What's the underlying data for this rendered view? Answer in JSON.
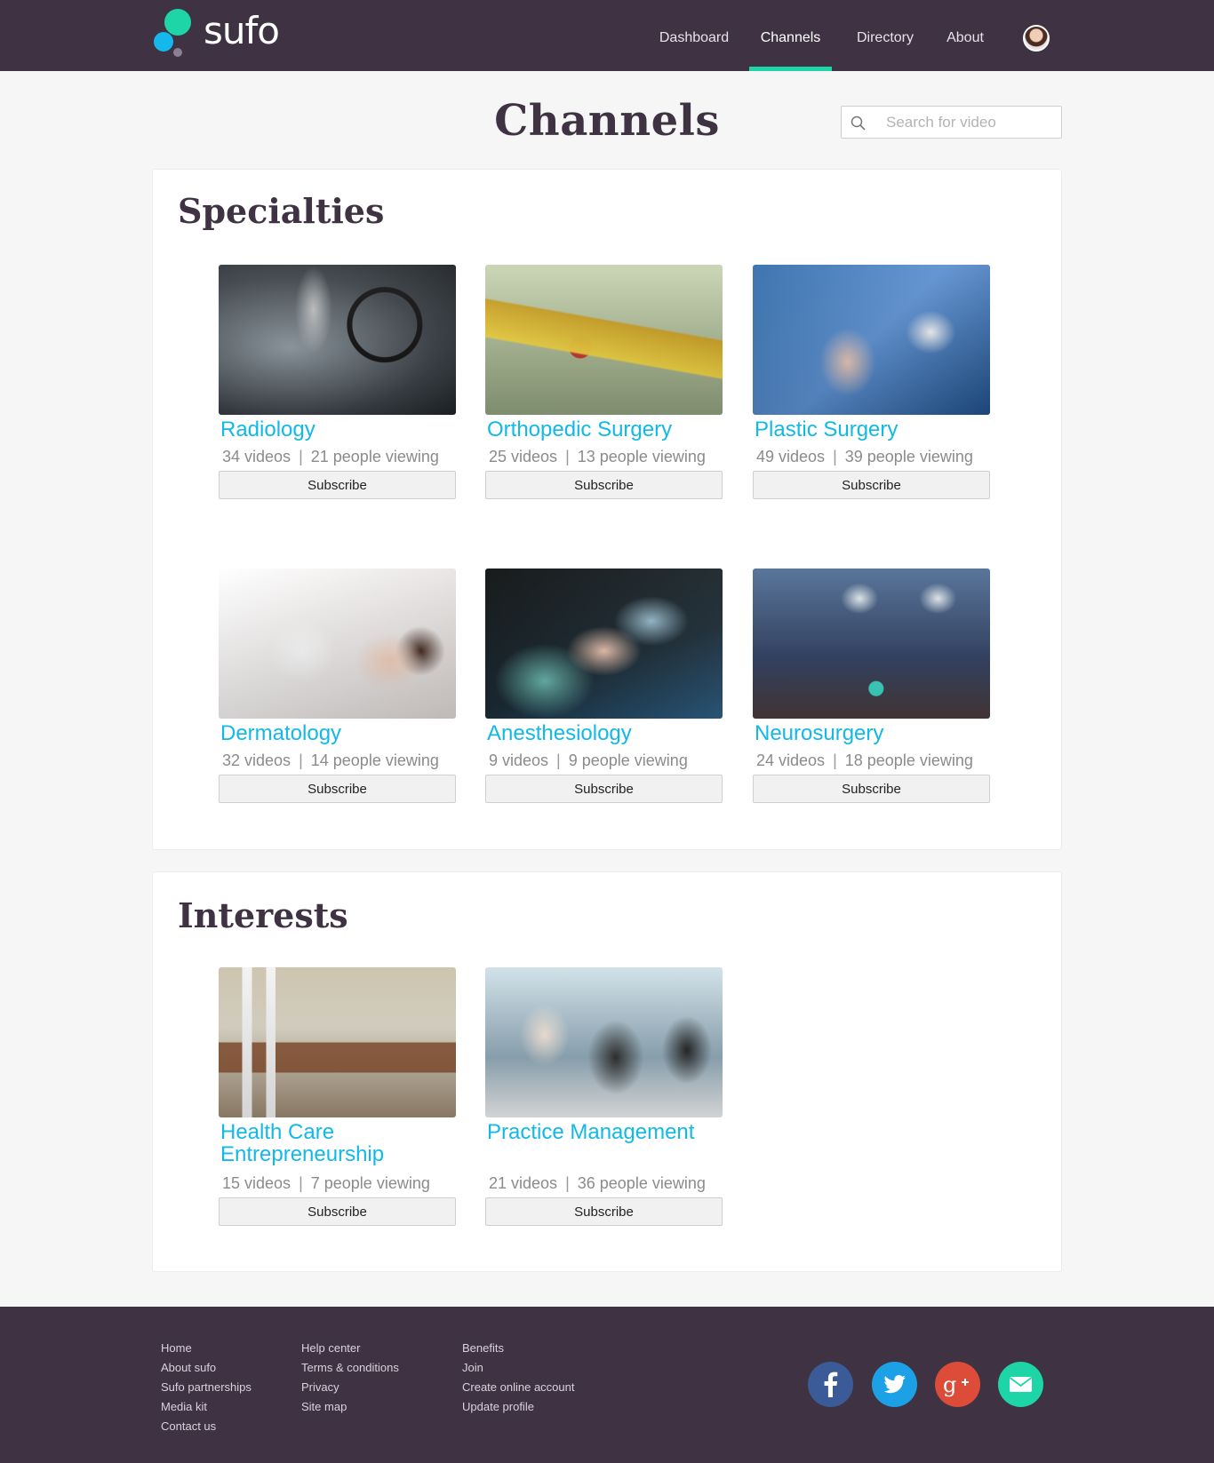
{
  "brand": {
    "name": "sufo"
  },
  "nav": {
    "items": [
      {
        "label": "Dashboard"
      },
      {
        "label": "Channels",
        "active": true
      },
      {
        "label": "Directory"
      },
      {
        "label": "About"
      }
    ]
  },
  "page": {
    "title": "Channels"
  },
  "search": {
    "placeholder": "Search for video"
  },
  "specialties": {
    "heading": "Specialties",
    "tiles": [
      {
        "title": "Radiology",
        "videos": "34 videos",
        "viewing": "21 people viewing",
        "button": "Subscribe"
      },
      {
        "title": "Orthopedic Surgery",
        "videos": "25 videos",
        "viewing": "13 people viewing",
        "button": "Subscribe"
      },
      {
        "title": "Plastic Surgery",
        "videos": "49 videos",
        "viewing": "39 people viewing",
        "button": "Subscribe"
      },
      {
        "title": "Dermatology",
        "videos": "32 videos",
        "viewing": "14 people viewing",
        "button": "Subscribe"
      },
      {
        "title": "Anesthesiology",
        "videos": "9 videos",
        "viewing": "9 people viewing",
        "button": "Subscribe"
      },
      {
        "title": "Neurosurgery",
        "videos": "24 videos",
        "viewing": "18 people viewing",
        "button": "Subscribe"
      }
    ]
  },
  "interests": {
    "heading": "Interests",
    "tiles": [
      {
        "title": "Health Care Entrepreneurship",
        "videos": "15 videos",
        "viewing": "7 people viewing",
        "button": "Subscribe"
      },
      {
        "title": "Practice Management",
        "videos": "21 videos",
        "viewing": "36 people viewing",
        "button": "Subscribe"
      }
    ]
  },
  "stats_separator": "|",
  "footer": {
    "col1": [
      "Home",
      "About sufo",
      "Sufo partnerships",
      "Media kit",
      "Contact us"
    ],
    "col2": [
      "Help center",
      "Terms & conditions",
      "Privacy",
      "Site map"
    ],
    "col3": [
      "Benefits",
      "Join",
      "Create online account",
      "Update profile"
    ],
    "social": [
      {
        "icon": "facebook-icon",
        "color": "#3a5a98"
      },
      {
        "icon": "twitter-icon",
        "color": "#1da1e6"
      },
      {
        "icon": "google-plus-icon",
        "color": "#dd4b39"
      },
      {
        "icon": "email-icon",
        "color": "#1ed5a8"
      }
    ]
  },
  "colors": {
    "header_bg": "#3f3343",
    "accent_green": "#1ed5a8",
    "link_blue": "#10b9e8",
    "title_purple": "#3f3343"
  }
}
